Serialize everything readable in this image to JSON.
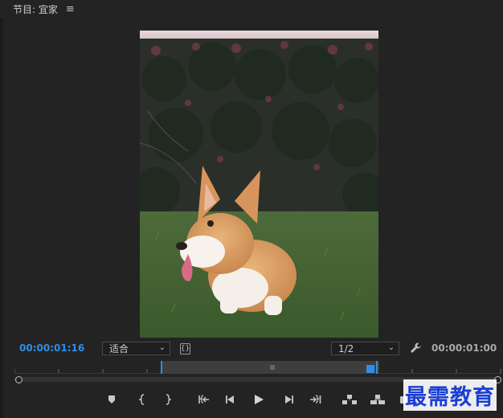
{
  "panel": {
    "title": "节目: 宜家",
    "menu_icon": "hamburger-menu-icon"
  },
  "playback": {
    "current_timecode": "00:00:01:16",
    "duration_timecode": "00:00:01:00",
    "fit_label": "适合",
    "resolution_label": "1/2",
    "accent_color": "#2f8fe6"
  },
  "controls": [
    "add-marker-icon",
    "mark-in-icon",
    "mark-out-icon",
    "go-to-in-icon",
    "step-back-icon",
    "play-icon",
    "step-forward-icon",
    "go-to-out-icon",
    "lift-icon",
    "extract-icon",
    "export-frame-icon"
  ],
  "watermark": {
    "text": "最需教育"
  }
}
